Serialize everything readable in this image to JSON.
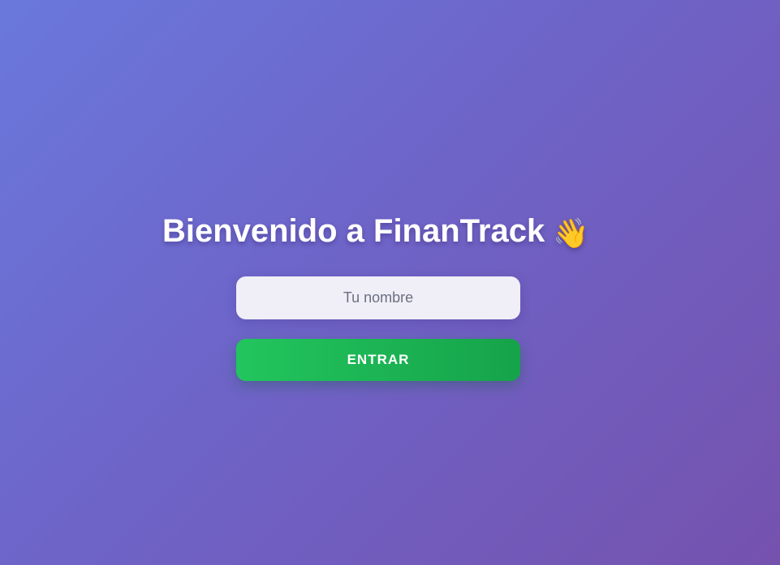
{
  "welcome": {
    "title": "Bienvenido a FinanTrack",
    "title_icon": "waving-hand-icon",
    "title_emoji": "👋"
  },
  "login_form": {
    "name_placeholder": "Tu nombre",
    "name_value": "",
    "submit_label": "ENTRAR"
  },
  "colors": {
    "background_start": "#6a78dc",
    "background_end": "#7552ae",
    "button_start": "#22c55e",
    "button_end": "#16a34a",
    "input_background": "#f0eff8"
  }
}
